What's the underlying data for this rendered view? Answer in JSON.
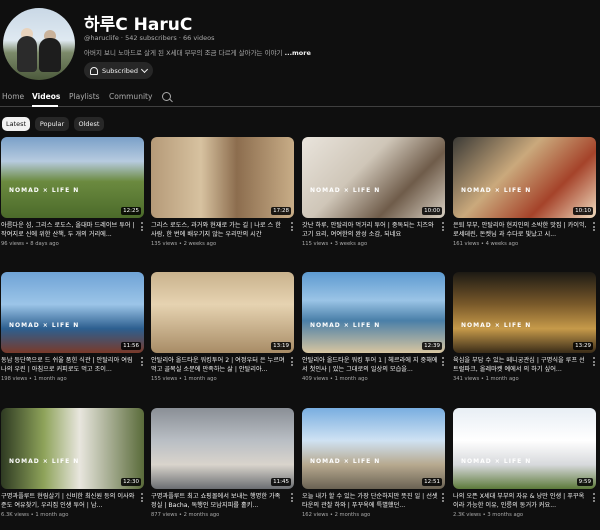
{
  "channel": {
    "name": "하루C HaruC",
    "meta": "@haruclife · 542 subscribers · 66 videos",
    "description": "아버지 보니 노마드로 살게 된 X세대 부부의 조금 다르게 살아가는 이야기",
    "more_label": "...more",
    "subscribe_label": "Subscribed"
  },
  "tabs": [
    {
      "label": "Home"
    },
    {
      "label": "Videos"
    },
    {
      "label": "Playlists"
    },
    {
      "label": "Community"
    }
  ],
  "filters": [
    {
      "label": "Latest"
    },
    {
      "label": "Popular"
    },
    {
      "label": "Oldest"
    }
  ],
  "videos": [
    {
      "title": "아름다운 섬, 그리스 로도스, 올대마 드레이브 투어 | 작여지로 신에 위한 산책, 두 개의 거리에...",
      "views": "96 views",
      "age": "8 days ago",
      "duration": "12:25",
      "overlay": "NOMAD × LIFE N"
    },
    {
      "title": "그리스 로도스, 과거와 현재로 가는 길 | 나로 스 한 사람, 한 번에 배우기지 않는 우리만의 시간",
      "views": "135 views",
      "age": "2 weeks ago",
      "duration": "17:28",
      "overlay": ""
    },
    {
      "title": "갓난 하루, 안탈리아 먹거리 투어 | 중독되는 치즈와 고기 요리, 여여한의 완성 소감, 되네요",
      "views": "115 views",
      "age": "3 weeks ago",
      "duration": "10:00",
      "overlay": "NOMAD × LIFE N"
    },
    {
      "title": "은퇴 부부, 안탈리아 현지인의 소박한 맛집 | 카이익, 로세데린, 돈켓님 과 수다로 빛났고 시...",
      "views": "161 views",
      "age": "4 weeks ago",
      "duration": "10:10",
      "overlay": "NOMAD × LIFE N"
    },
    {
      "title": "동남 등단쪽으로 드 쉬울 품힌 식관 | 안탈리아 여림나의 우린 | 아침으로 커피로도 먹고 조이...",
      "views": "198 views",
      "age": "1 month ago",
      "duration": "11:56",
      "overlay": "NOMAD × LIFE N"
    },
    {
      "title": "안탈리아 올드타운 워킹투어 2 | 여정우터 은 누르며 먹고 골목실 소문에 만족하는 삶 | 안탈리아...",
      "views": "155 views",
      "age": "1 month ago",
      "duration": "13:19",
      "overlay": ""
    },
    {
      "title": "안탈리아 올드타운 워킹 투어 1 | 헤르라에 지 중해에서 첫인사 | 있는 그대로의 일상의 모습을...",
      "views": "409 views",
      "age": "1 month ago",
      "duration": "12:39",
      "overlay": "NOMAD × LIFE N"
    },
    {
      "title": "육심을 부담 수 있는 떼니궁관심 | 구명식을 루프 선트럴파크, 올레마켓 예에서 의 하기 싶어...",
      "views": "341 views",
      "age": "1 month ago",
      "duration": "13:29",
      "overlay": "NOMAD × LIFE N"
    },
    {
      "title": "구명과플루트 현림살기 | 신비한 최신원 등의 이사와 준도 여유찾기, 우리집 인생 투어 | 남...",
      "views": "6.3K views",
      "age": "1 month ago",
      "duration": "12:30",
      "overlay": "NOMAD × LIFE N"
    },
    {
      "title": "구명과플루트 최고 쇼핑몰에서 보내는 행명한 가족 정실 | Bacha, 독행인 모남지피를 홀키...",
      "views": "877 views",
      "age": "2 months ago",
      "duration": "11:45",
      "overlay": ""
    },
    {
      "title": "오늘 내가 할 수 있는 가장 단순하지만 뜻진 일 | 선셋타운의 관찰 하와 | 푸꾸옥에 특별했던...",
      "views": "162 views",
      "age": "2 months ago",
      "duration": "12:51",
      "overlay": "NOMAD × LIFE N"
    },
    {
      "title": "나의 오픈 X세대 부부의 자유 & 낭만 인생 | 푸꾸옥이라 가능한 이유, 인릉의 동거가 커요...",
      "views": "2.3K views",
      "age": "3 months ago",
      "duration": "9:59",
      "overlay": "NOMAD × LIFE N"
    }
  ]
}
